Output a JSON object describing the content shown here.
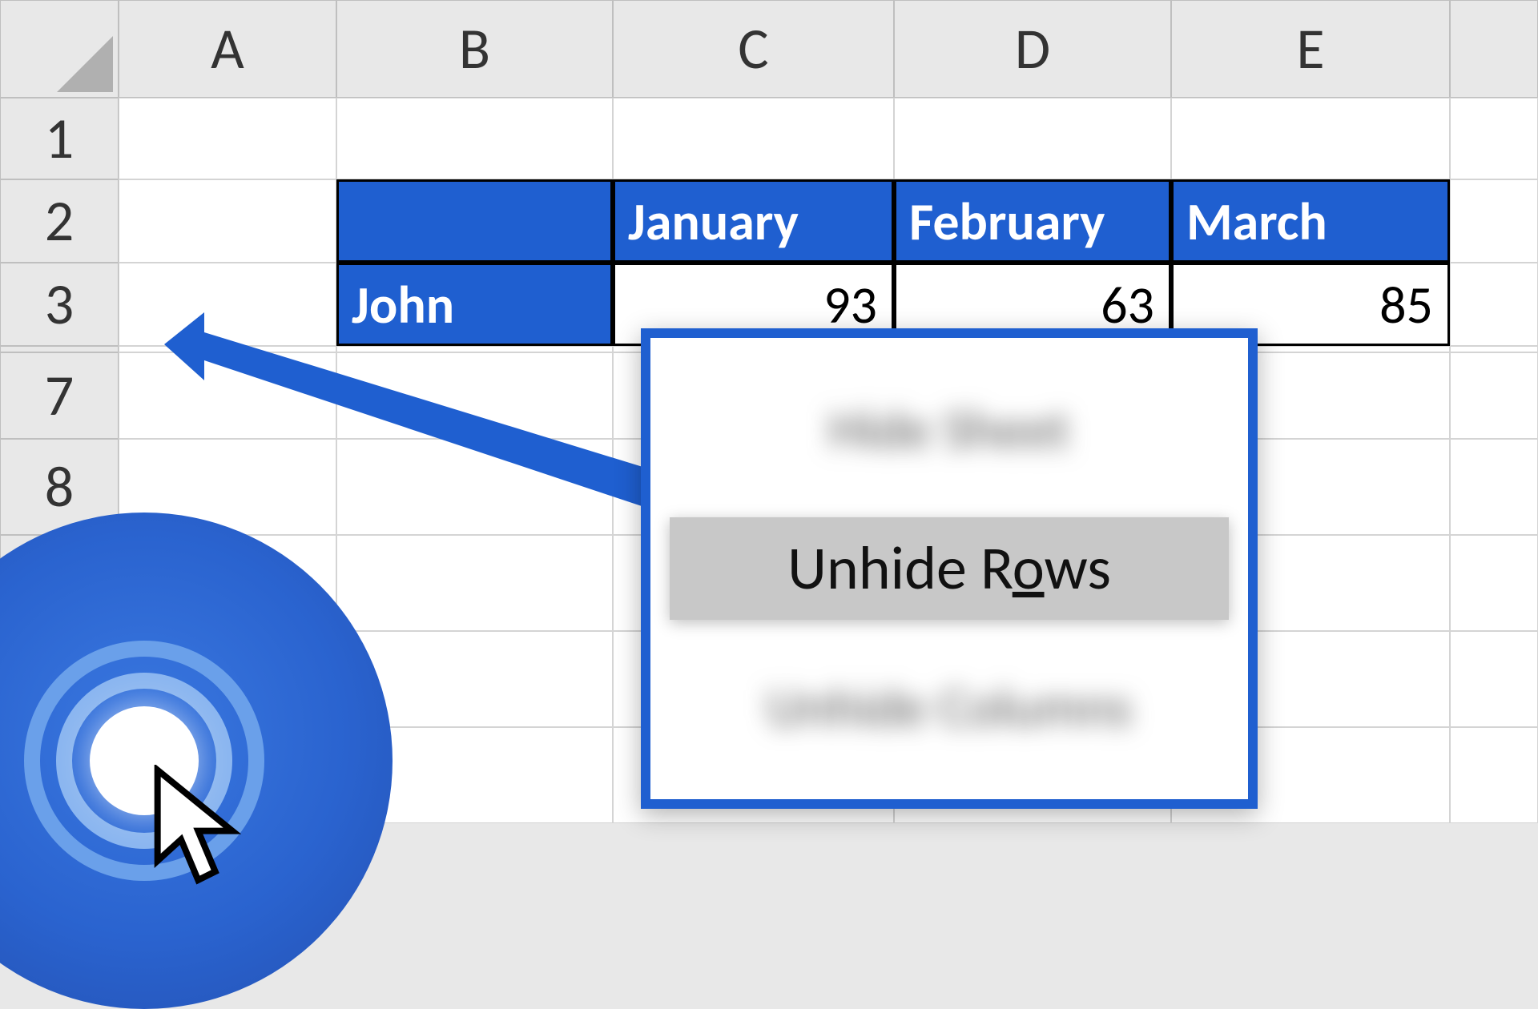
{
  "columns": [
    "A",
    "B",
    "C",
    "D",
    "E"
  ],
  "rows": [
    "1",
    "2",
    "3",
    "7",
    "8"
  ],
  "table": {
    "header_blank": "",
    "months": {
      "c": "January",
      "d": "February",
      "e": "March"
    },
    "name": "John",
    "values": {
      "c": "93",
      "d": "63",
      "e": "85"
    }
  },
  "menu": {
    "above": "Hide Sheet",
    "focused_pre": "Unhide R",
    "focused_u": "o",
    "focused_post": "ws",
    "below": "Unhide Columns"
  }
}
